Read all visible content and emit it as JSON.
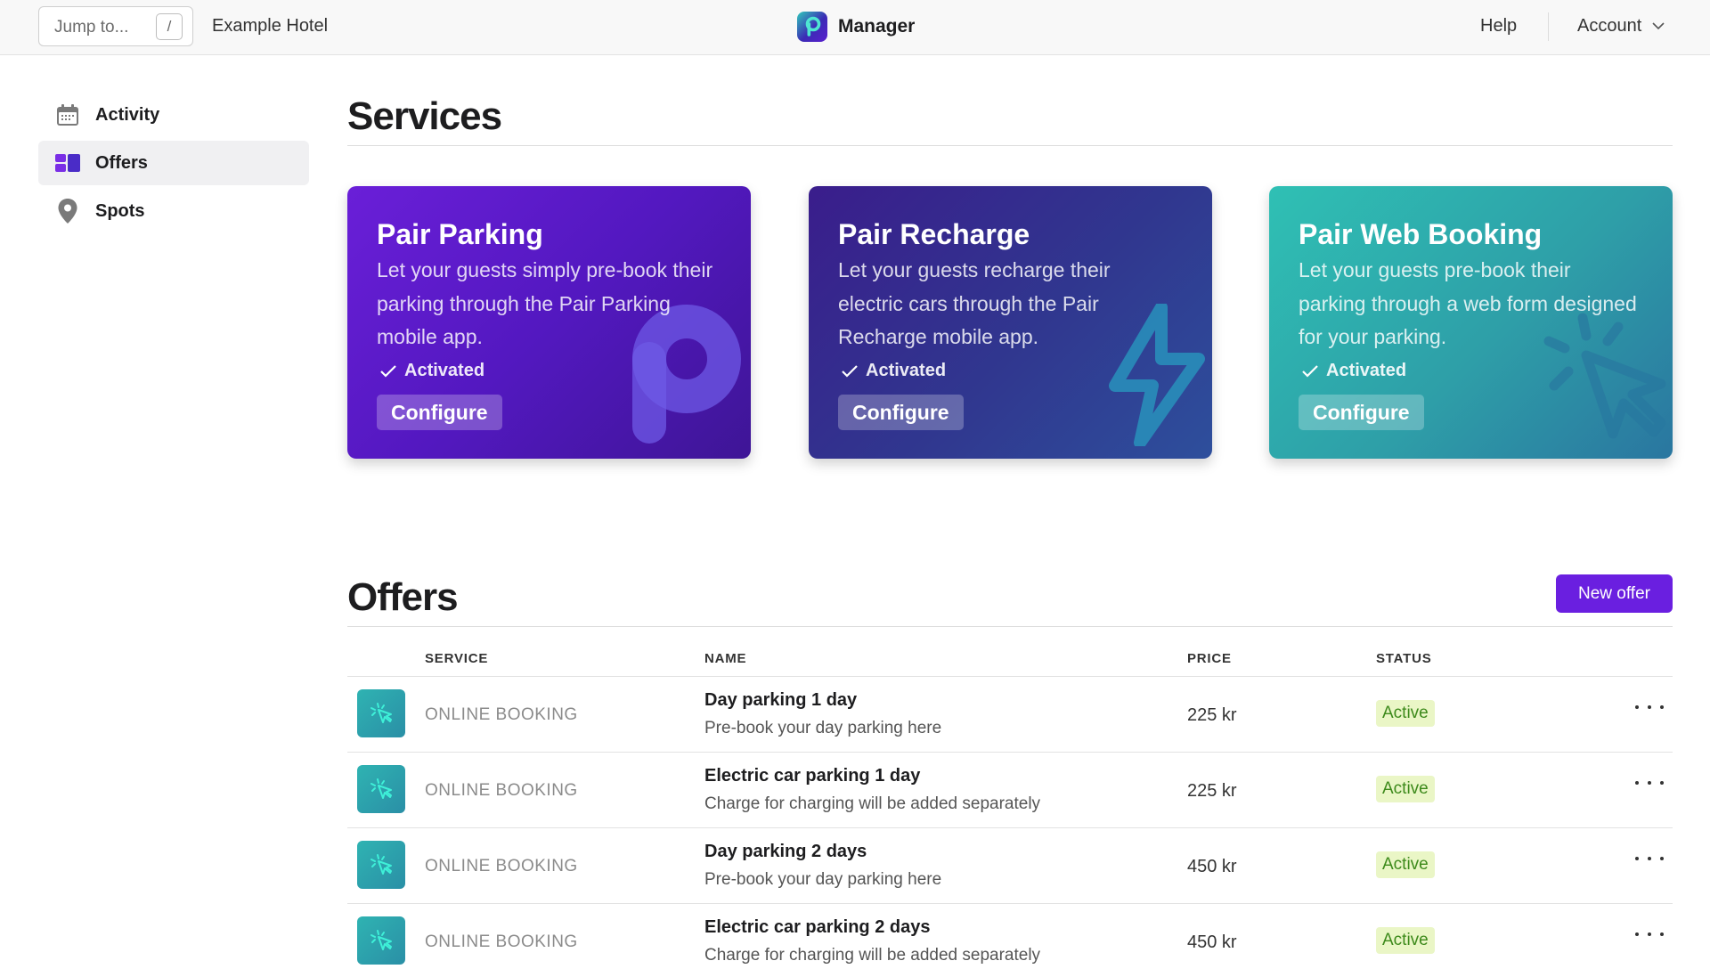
{
  "topbar": {
    "jump_placeholder": "Jump to...",
    "jump_shortcut": "/",
    "hotel_name": "Example Hotel",
    "app_name": "Manager",
    "help_label": "Help",
    "account_label": "Account"
  },
  "sidebar": {
    "items": [
      {
        "label": "Activity",
        "icon": "calendar-icon",
        "active": false
      },
      {
        "label": "Offers",
        "icon": "offers-grid-icon",
        "active": true
      },
      {
        "label": "Spots",
        "icon": "map-pin-icon",
        "active": false
      }
    ]
  },
  "services": {
    "title": "Services",
    "cards": [
      {
        "title": "Pair Parking",
        "description": "Let your guests simply pre-book their parking through the Pair Parking mobile app.",
        "status": "Activated",
        "button": "Configure",
        "icon": "parking-p-icon"
      },
      {
        "title": "Pair Recharge",
        "description": "Let your guests recharge their electric cars through the Pair Recharge mobile app.",
        "status": "Activated",
        "button": "Configure",
        "icon": "lightning-icon"
      },
      {
        "title": "Pair Web Booking",
        "description": "Let your guests pre-book their parking through a web form designed for your parking.",
        "status": "Activated",
        "button": "Configure",
        "icon": "cursor-click-icon"
      }
    ]
  },
  "offers": {
    "title": "Offers",
    "new_button": "New offer",
    "columns": {
      "service": "SERVICE",
      "name": "NAME",
      "price": "PRICE",
      "status": "STATUS"
    },
    "rows": [
      {
        "service": "ONLINE BOOKING",
        "name": "Day parking 1 day",
        "description": "Pre-book your day parking here",
        "price": "225 kr",
        "status": "Active"
      },
      {
        "service": "ONLINE BOOKING",
        "name": "Electric car parking 1 day",
        "description": "Charge for charging will be added separately",
        "price": "225 kr",
        "status": "Active"
      },
      {
        "service": "ONLINE BOOKING",
        "name": "Day parking 2 days",
        "description": "Pre-book your day parking here",
        "price": "450 kr",
        "status": "Active"
      },
      {
        "service": "ONLINE BOOKING",
        "name": "Electric car parking 2 days",
        "description": "Charge for charging will be added separately",
        "price": "450 kr",
        "status": "Active"
      }
    ]
  },
  "colors": {
    "accent": "#6a1fe0",
    "status_active_bg": "#eaf6c6",
    "status_active_text": "#3d8a1b",
    "parking_card": "#5a1bc8",
    "recharge_card": "#33368f",
    "web_card": "#2ea3a9"
  }
}
